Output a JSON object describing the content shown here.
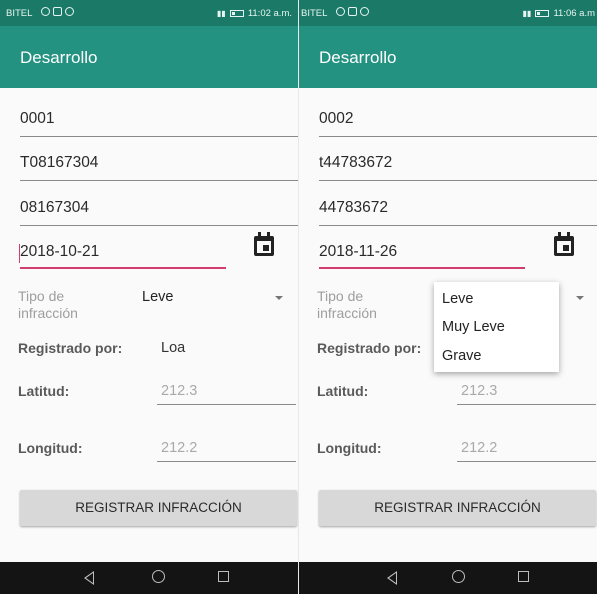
{
  "screens": [
    {
      "status": {
        "carrier": "BITEL",
        "time": "11:02 a.m."
      },
      "app_title": "Desarrollo",
      "code": "0001",
      "plate": "T08167304",
      "document": "08167304",
      "date": "2018-10-21",
      "tipo_label": "Tipo de\ninfracción",
      "tipo_value": "Leve",
      "registrado_label": "Registrado por:",
      "registrado_value": "Loa",
      "latitud_label": "Latitud:",
      "latitud_value": "212.3",
      "longitud_label": "Longitud:",
      "longitud_value": "212.2",
      "register_button": "REGISTRAR INFRACCIÓN"
    },
    {
      "status": {
        "carrier": "BITEL",
        "time": "11:06 a.m"
      },
      "app_title": "Desarrollo",
      "code": "0002",
      "plate": "t44783672",
      "document": "44783672",
      "date": "2018-11-26",
      "tipo_label": "Tipo de\ninfracción",
      "tipo_value": "",
      "registrado_label": "Registrado por:",
      "registrado_value": "",
      "latitud_label": "Latitud:",
      "latitud_value": "212.3",
      "longitud_label": "Longitud:",
      "longitud_value": "212.2",
      "register_button": "REGISTRAR INFRACCIÓN",
      "dropdown_options": [
        "Leve",
        "Muy Leve",
        "Grave"
      ]
    }
  ],
  "colors": {
    "statusbar": "#1a7a67",
    "appbar": "#239281",
    "accent": "#cf3e6f",
    "navbar": "#141414"
  },
  "icons": [
    "calendar-icon",
    "dropdown-arrow-icon",
    "nav-back-icon",
    "nav-home-icon",
    "nav-recents-icon"
  ]
}
